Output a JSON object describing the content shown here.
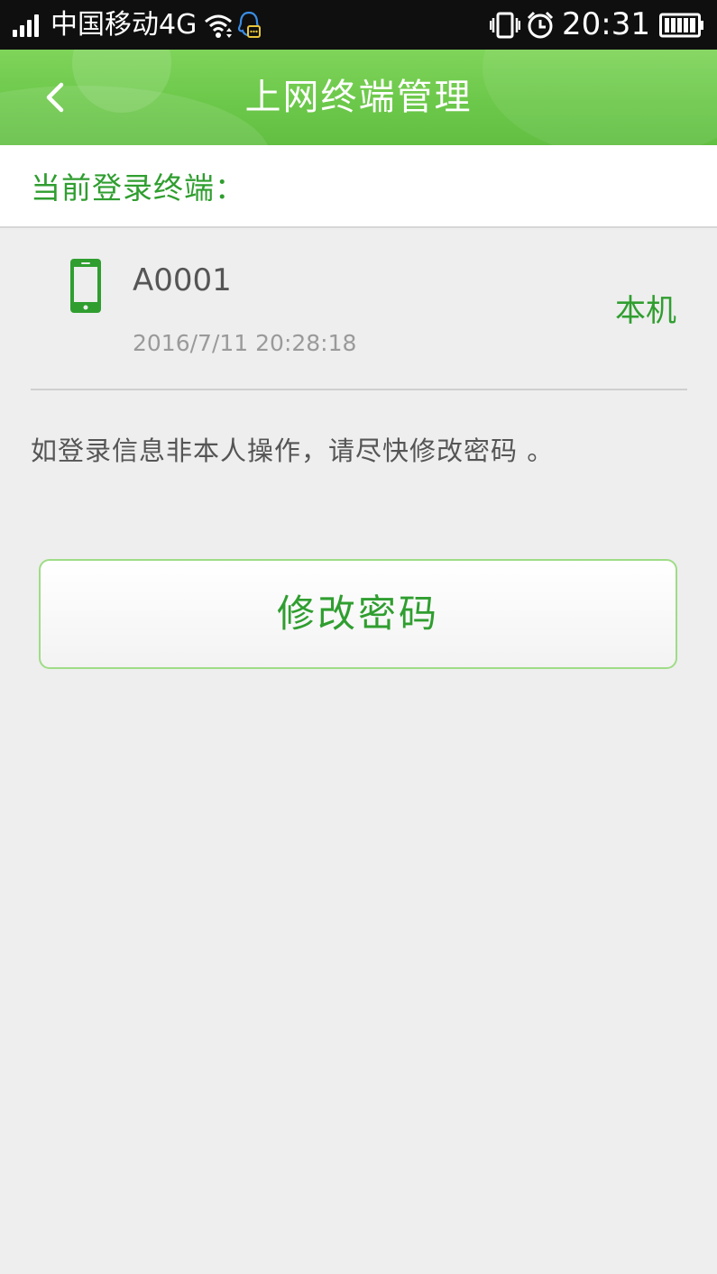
{
  "status_bar": {
    "carrier": "中国移动4G",
    "time": "20:31",
    "icons": [
      "signal-icon",
      "wifi-icon",
      "qq-icon",
      "vibrate-icon",
      "alarm-icon",
      "battery-icon"
    ]
  },
  "header": {
    "title": "上网终端管理",
    "back_icon": "back-arrow-icon"
  },
  "section": {
    "title": "当前登录终端："
  },
  "device": {
    "icon": "phone-icon",
    "name": "A0001",
    "login_time": "2016/7/11 20:28:18",
    "tag": "本机"
  },
  "notice": "如登录信息非本人操作，请尽快修改密码 。",
  "action": {
    "change_password_label": "修改密码"
  },
  "colors": {
    "accent_green": "#2f9e2f",
    "header_green": "#6cc84a",
    "background": "#eeeeee"
  }
}
